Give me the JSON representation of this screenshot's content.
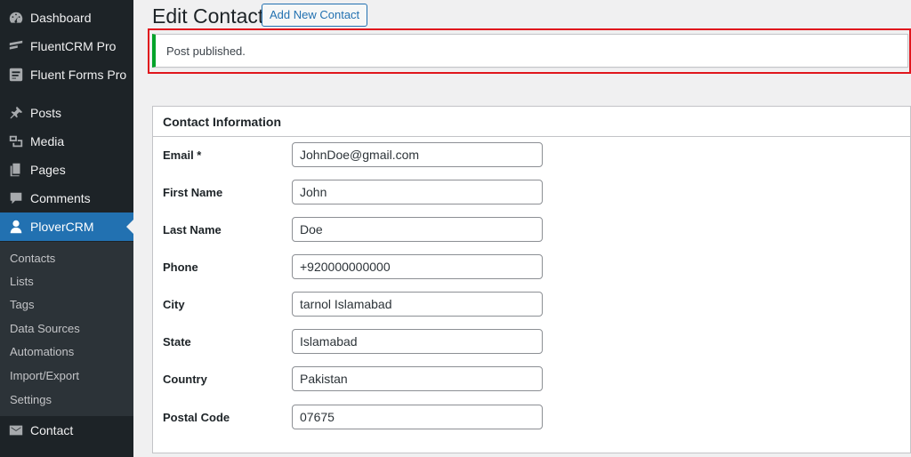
{
  "sidebar": {
    "items": [
      {
        "label": "Dashboard",
        "icon": "dashboard-icon"
      },
      {
        "label": "FluentCRM Pro",
        "icon": "fluentcrm-icon"
      },
      {
        "label": "Fluent Forms Pro",
        "icon": "fluentforms-icon"
      },
      {
        "label": "Posts",
        "icon": "pushpin-icon"
      },
      {
        "label": "Media",
        "icon": "media-icon"
      },
      {
        "label": "Pages",
        "icon": "pages-icon"
      },
      {
        "label": "Comments",
        "icon": "comments-icon"
      },
      {
        "label": "PloverCRM",
        "icon": "user-icon"
      },
      {
        "label": "Contact",
        "icon": "envelope-icon"
      }
    ],
    "submenu": [
      "Contacts",
      "Lists",
      "Tags",
      "Data Sources",
      "Automations",
      "Import/Export",
      "Settings"
    ],
    "active_color": "#2271b1"
  },
  "page": {
    "title": "Edit Contact",
    "add_new_label": "Add New Contact"
  },
  "notice": {
    "text": "Post published.",
    "accent_color": "#00a32a",
    "highlight_color": "#e0161d"
  },
  "panel": {
    "title": "Contact Information",
    "fields": [
      {
        "label": "Email *",
        "value": "JohnDoe@gmail.com"
      },
      {
        "label": "First Name",
        "value": "John"
      },
      {
        "label": "Last Name",
        "value": "Doe"
      },
      {
        "label": "Phone",
        "value": "+920000000000"
      },
      {
        "label": "City",
        "value": "tarnol Islamabad"
      },
      {
        "label": "State",
        "value": "Islamabad"
      },
      {
        "label": "Country",
        "value": "Pakistan"
      },
      {
        "label": "Postal Code",
        "value": "07675"
      }
    ]
  }
}
